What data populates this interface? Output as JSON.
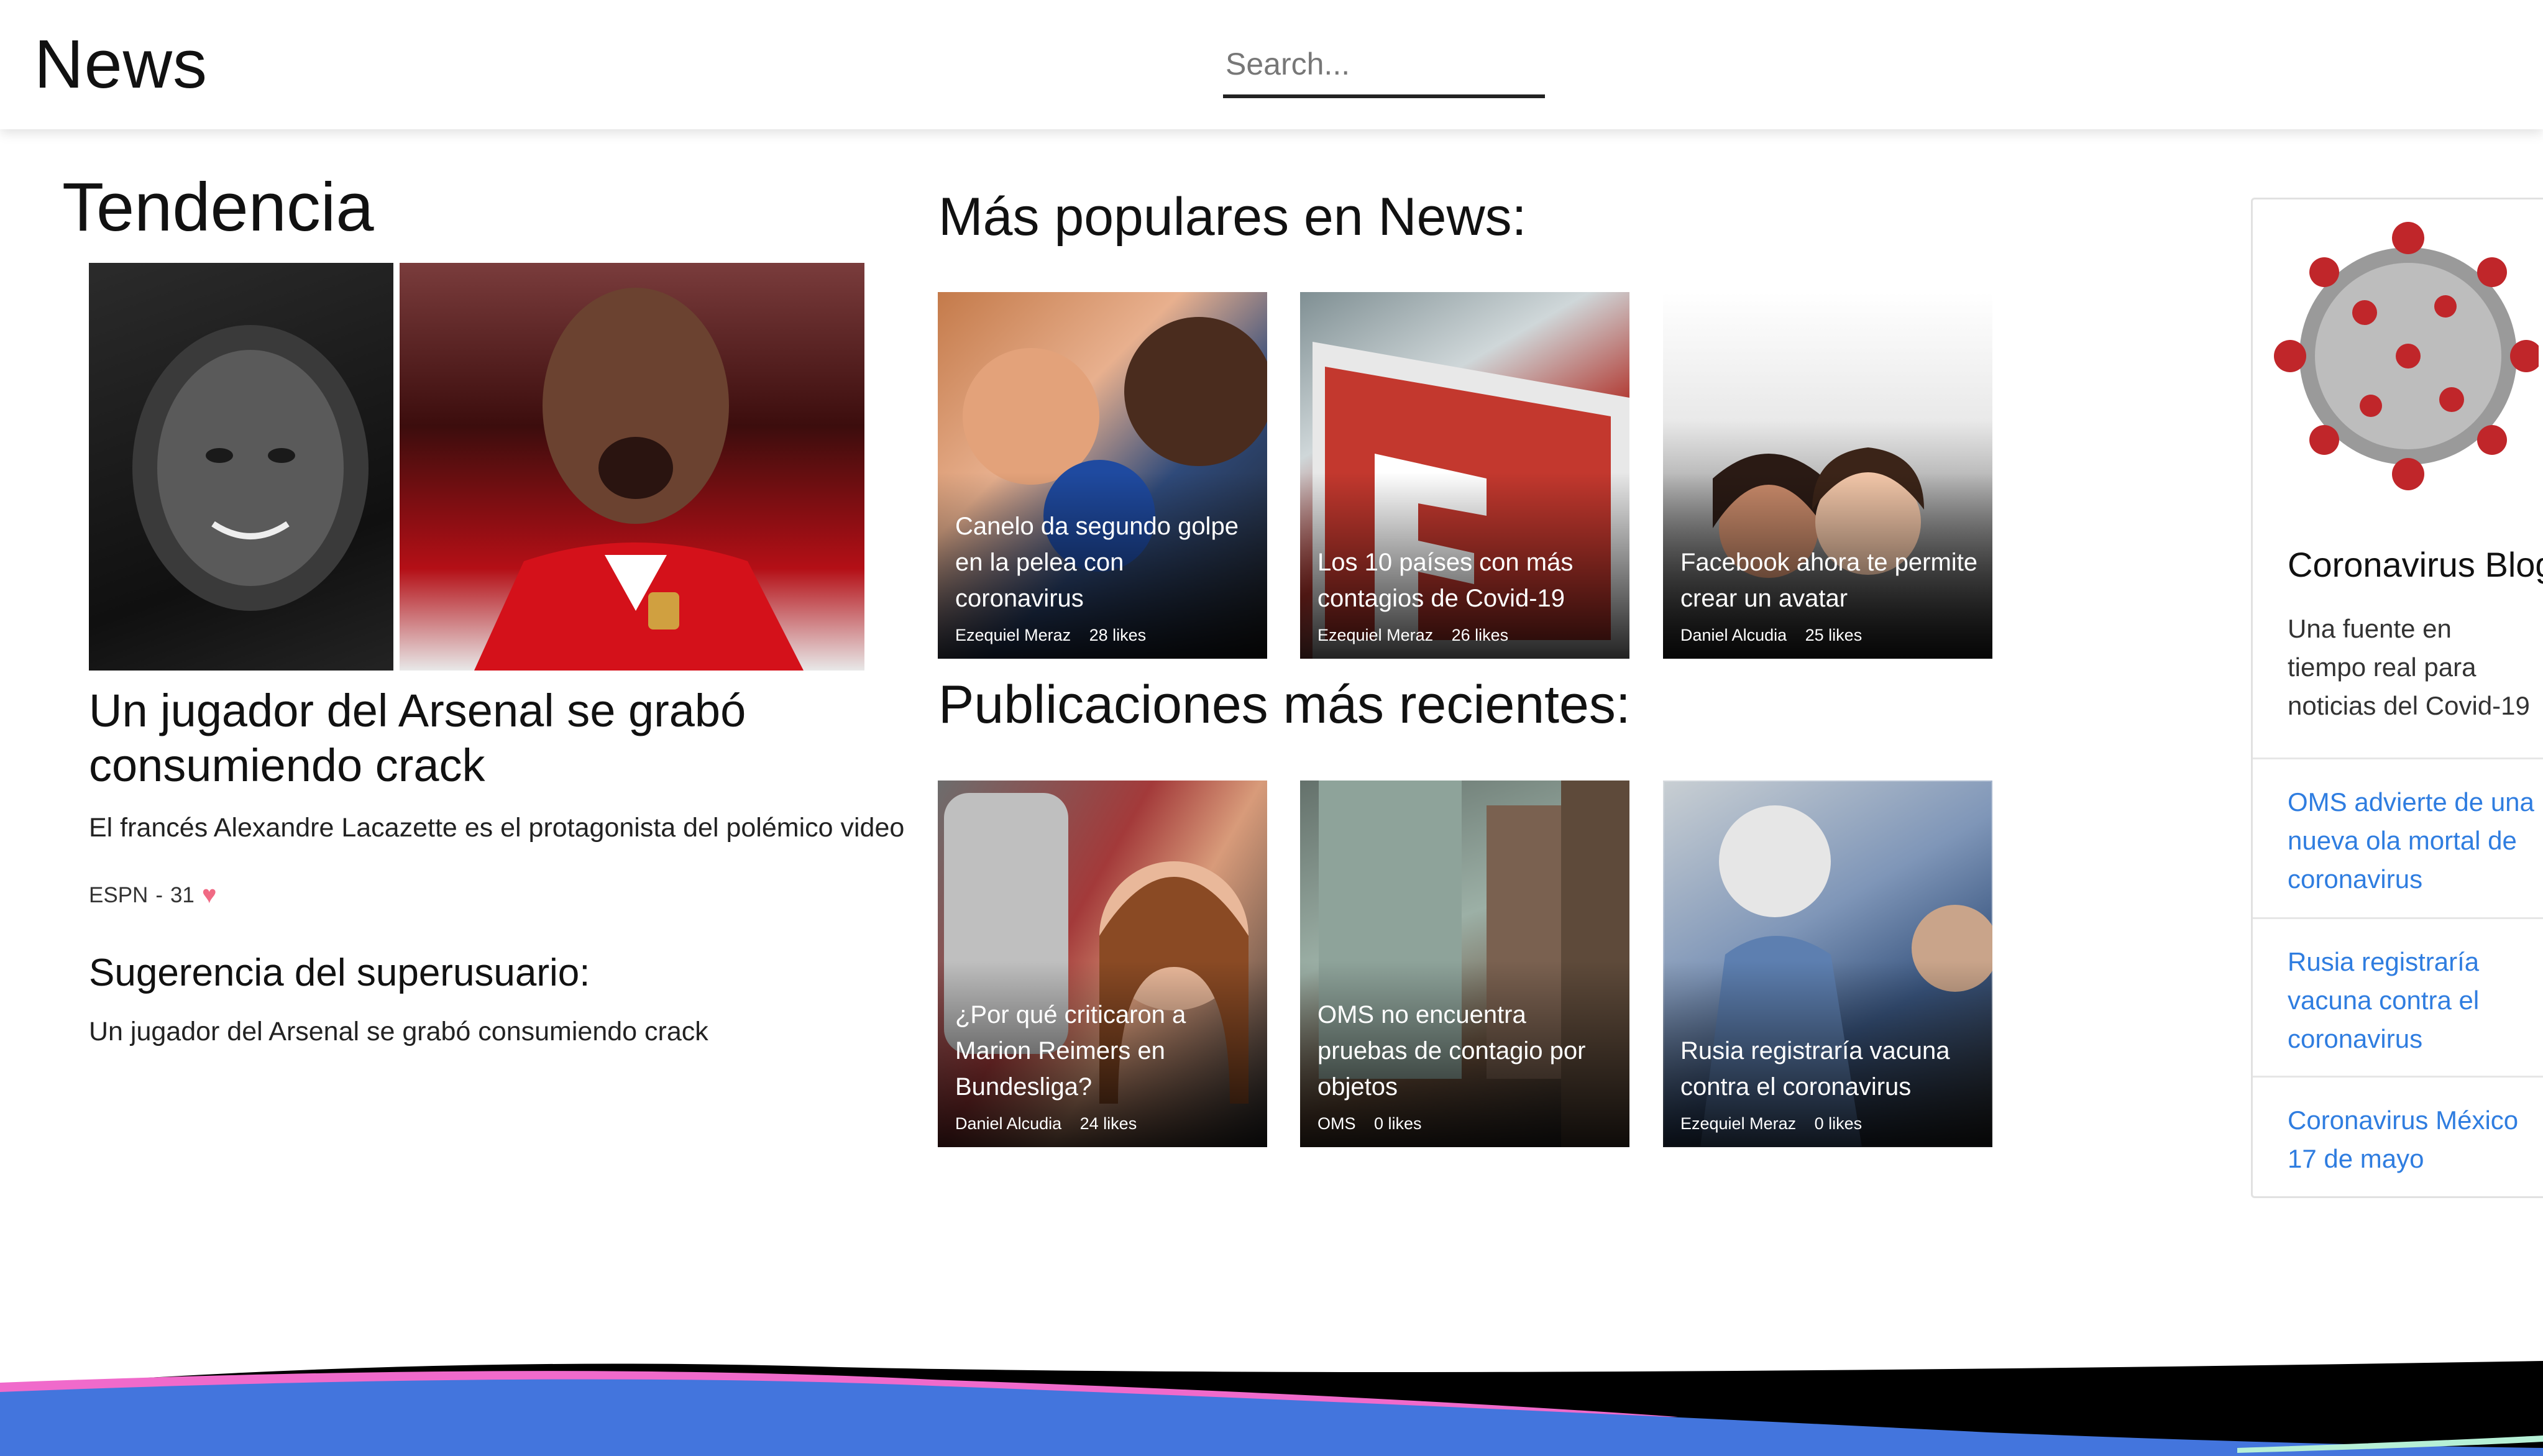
{
  "header": {
    "brand": "News",
    "search_placeholder": "Search..."
  },
  "trending": {
    "title": "Tendencia",
    "headline": "Un jugador del Arsenal se grabó consumiendo crack",
    "description": "El francés Alexandre Lacazette es el protagonista del polémico video",
    "source": "ESPN",
    "separator": "-",
    "likes": "31",
    "suggestion_title": "Sugerencia del superusuario:",
    "suggestion_text": "Un jugador del Arsenal se grabó consumiendo crack"
  },
  "popular": {
    "title": "Más populares en News:",
    "cards": [
      {
        "caption": "Canelo da segundo golpe en la pelea con coronavirus",
        "author": "Ezequiel Meraz",
        "likes": "28 likes"
      },
      {
        "caption": "Los 10 países con más contagios de Covid-19",
        "author": "Ezequiel Meraz",
        "likes": "26 likes"
      },
      {
        "caption": "Facebook ahora te permite crear un avatar",
        "author": "Daniel Alcudia",
        "likes": "25 likes"
      }
    ]
  },
  "recent": {
    "title": "Publicaciones más recientes:",
    "cards": [
      {
        "caption": "¿Por qué criticaron a Marion Reimers en Bundesliga?",
        "author": "Daniel Alcudia",
        "likes": "24 likes"
      },
      {
        "caption": "OMS no encuentra pruebas de contagio por objetos",
        "author": "OMS",
        "likes": "0 likes"
      },
      {
        "caption": "Rusia registraría vacuna contra el coronavirus",
        "author": "Ezequiel Meraz",
        "likes": "0 likes"
      }
    ]
  },
  "sidebar": {
    "title": "Coronavirus Blog",
    "description": "Una fuente en tiempo real para noticias del Covid-19",
    "links": [
      "OMS advierte de una nueva ola mortal de coronavirus",
      "Rusia registraría vacuna contra el coronavirus",
      "Coronavirus México 17 de mayo"
    ]
  },
  "colors": {
    "link": "#2f7de0",
    "heart": "#f06a84",
    "wave_blue": "#4375dd",
    "wave_pink": "#f06acb",
    "wave_black": "#000000",
    "wave_mint": "#b6f0d6"
  }
}
